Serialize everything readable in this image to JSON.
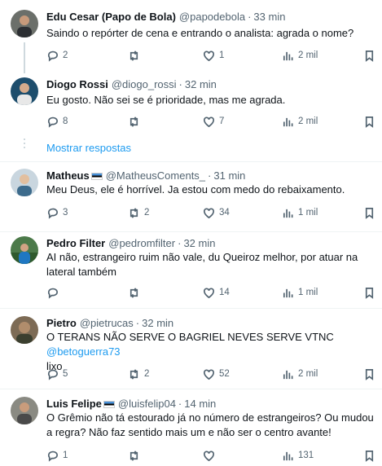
{
  "tweets": [
    {
      "name": "Edu Cesar (Papo de Bola)",
      "handle": "@papodebola",
      "sep": "·",
      "time": "33 min",
      "text": "Saindo o repórter de cena e entrando o analista: agrada o nome?",
      "replies": "2",
      "retweets": "",
      "likes": "1",
      "views": "2 mil"
    },
    {
      "name": "Diogo Rossi",
      "handle": "@diogo_rossi",
      "sep": "·",
      "time": "32 min",
      "text": "Eu gosto. Não sei se é prioridade, mas me agrada.",
      "replies": "8",
      "retweets": "",
      "likes": "7",
      "views": "2 mil"
    },
    {
      "name": "Matheus",
      "handle": "@MatheusComents_",
      "sep": "·",
      "time": "31 min",
      "text": "Meu Deus, ele é horrível. Ja estou com medo do rebaixamento.",
      "replies": "3",
      "retweets": "2",
      "likes": "34",
      "views": "1 mil"
    },
    {
      "name": "Pedro Filter",
      "handle": "@pedromfilter",
      "sep": "·",
      "time": "32 min",
      "text": "AI não, estrangeiro ruim não vale, du Queiroz melhor, por atuar na lateral também",
      "replies": "",
      "retweets": "",
      "likes": "14",
      "views": "1 mil"
    },
    {
      "name": "Pietro",
      "handle": "@pietrucas",
      "sep": "·",
      "time": "32 min",
      "text_pre": "O TERANS NÃO SERVE O BAGRIEL NEVES SERVE VTNC ",
      "text_mention": "@betoguerra73",
      "text_post": "lixo",
      "replies": "5",
      "retweets": "2",
      "likes": "52",
      "views": "2 mil"
    },
    {
      "name": "Luis Felipe",
      "handle": "@luisfelip04",
      "sep": "·",
      "time": "14 min",
      "text": "O Grêmio não tá estourado já no número de estrangeiros? Ou mudou a regra? Não faz sentido mais um e não ser o centro avante!",
      "replies": "1",
      "retweets": "",
      "likes": "",
      "views": "131"
    }
  ],
  "show_replies": "Mostrar respostas",
  "colors": {
    "link": "#1d9bf0",
    "secondary": "#536471",
    "text": "#0f1419",
    "border": "#eff3f4"
  }
}
